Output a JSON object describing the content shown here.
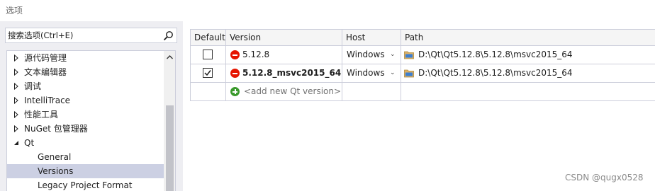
{
  "window": {
    "title": "选项"
  },
  "search": {
    "placeholder": "搜索选项(Ctrl+E)"
  },
  "tree": {
    "items": [
      {
        "label": "源代码管理",
        "state": "collapsed"
      },
      {
        "label": "文本编辑器",
        "state": "collapsed"
      },
      {
        "label": "调试",
        "state": "collapsed"
      },
      {
        "label": "IntelliTrace",
        "state": "collapsed"
      },
      {
        "label": "性能工具",
        "state": "collapsed"
      },
      {
        "label": "NuGet 包管理器",
        "state": "collapsed"
      },
      {
        "label": "Qt",
        "state": "expanded"
      },
      {
        "label": "General",
        "state": "child"
      },
      {
        "label": "Versions",
        "state": "child-selected"
      },
      {
        "label": "Legacy Project Format",
        "state": "child"
      }
    ]
  },
  "grid": {
    "headers": {
      "default": "Default",
      "version": "Version",
      "host": "Host",
      "path": "Path"
    },
    "rows": [
      {
        "checked": false,
        "version": "5.12.8",
        "bold": false,
        "host": "Windows",
        "path": "D:\\Qt\\Qt5.12.8\\5.12.8\\msvc2015_64"
      },
      {
        "checked": true,
        "version": "5.12.8_msvc2015_64",
        "bold": true,
        "host": "Windows",
        "path": "D:\\Qt\\Qt5.12.8\\5.12.8\\msvc2015_64"
      }
    ],
    "add_row": {
      "label": "<add new Qt version>"
    }
  },
  "icons": {
    "search": "search-icon",
    "default_marker": "stop-icon",
    "path": "folder-icon",
    "add": "add-icon",
    "dropdown": "chevron-down-icon"
  },
  "colors": {
    "selection": "#ccd0e3",
    "stop": "#e51400",
    "add": "#3a9a2c",
    "pane_background": "#eeeef2"
  },
  "watermark": {
    "text": "CSDN @qugx0528"
  }
}
